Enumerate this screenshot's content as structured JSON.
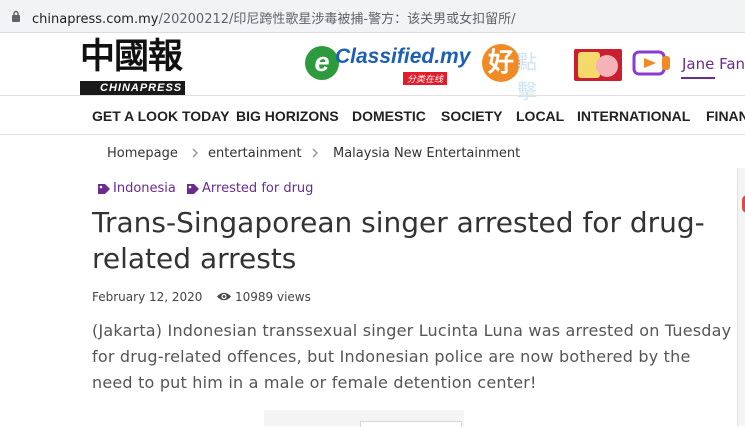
{
  "browser": {
    "url_host": "chinapress.com.my",
    "url_path": "/20200212/印尼跨性歌星涉毒被捕-警方：该关男或女扣留所/"
  },
  "header": {
    "logo_cn": "中國報",
    "logo_en": "CHINAPRESS",
    "eclassified": {
      "e": "e",
      "text": "Classified.my",
      "sub": "分类在线",
      "hao": "好",
      "faint": "點擊"
    },
    "user_name": "Jane Fan"
  },
  "nav": {
    "items": [
      "GET A LOOK TODAY",
      "BIG HORIZONS",
      "DOMESTIC",
      "SOCIETY",
      "LOCAL",
      "INTERNATIONAL",
      "FINAN"
    ]
  },
  "breadcrumb": {
    "items": [
      "Homepage",
      "entertainment",
      "Malaysia New Entertainment"
    ]
  },
  "tags": [
    "Indonesia",
    "Arrested for drug"
  ],
  "article": {
    "headline": "Trans-Singaporean singer arrested for drug-related arrests",
    "date": "February 12, 2020",
    "views": "10989 views",
    "body": "(Jakarta) Indonesian transsexual singer Lucinta Luna was arrested on Tuesday for drug-related offences, but Indonesian police are now bothered by the need to put him in a male or female detention center!"
  },
  "colors": {
    "brand_purple": "#6a2c8e",
    "eclassified_blue": "#1d5fb4",
    "eclassified_green": "#2e9a3e",
    "eclassified_orange": "#f08a24"
  },
  "icons": [
    "lock-icon",
    "chevron-right-icon",
    "tag-icon",
    "eye-icon",
    "tv-icon"
  ]
}
